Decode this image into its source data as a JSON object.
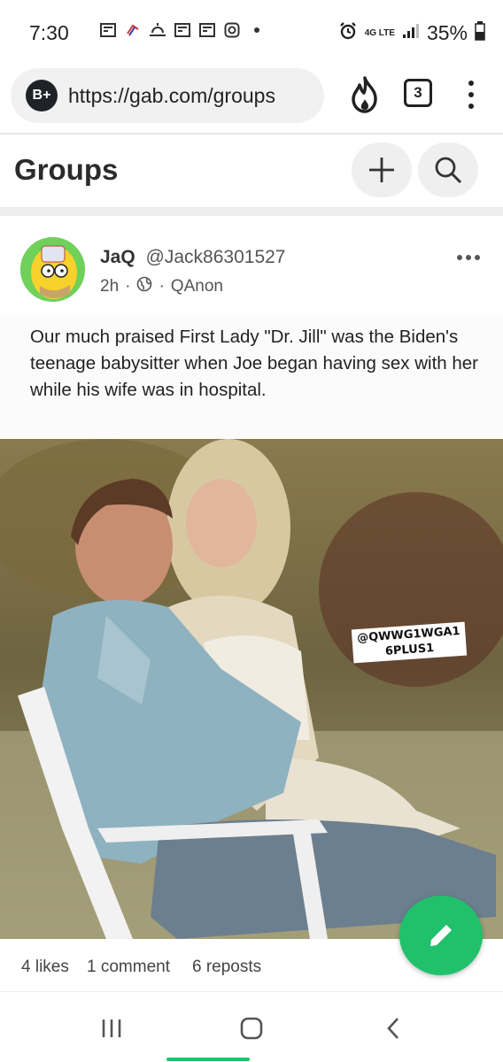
{
  "status_bar": {
    "time": "7:30",
    "network": "4G LTE",
    "battery": "35%",
    "icons": [
      "news-icon",
      "flag-icon",
      "weather-icon",
      "news-icon",
      "news-icon",
      "instagram-icon",
      "dot-icon",
      "alarm-icon",
      "signal-icon",
      "battery-icon"
    ]
  },
  "browser": {
    "brand": "B+",
    "url": "https://gab.com/groups",
    "tab_count": "3"
  },
  "header": {
    "title": "Groups"
  },
  "post": {
    "author_name": "JaQ",
    "author_handle": "@Jack86301527",
    "time": "2h",
    "separator": "·",
    "group": "QAnon",
    "caption": "Our much praised First Lady \"Dr. Jill\" was the Biden's teenage babysitter when Joe began having sex with her while his wife was in hospital.",
    "watermark_line1": "@QWWG1WGA1",
    "watermark_line2": "6PLUS1",
    "likes": "4 likes",
    "comments": "1 comment",
    "reposts": "6 reposts"
  },
  "colors": {
    "accent": "#21c16b",
    "pill": "#f1f1f1",
    "badge": "#1f2328"
  }
}
